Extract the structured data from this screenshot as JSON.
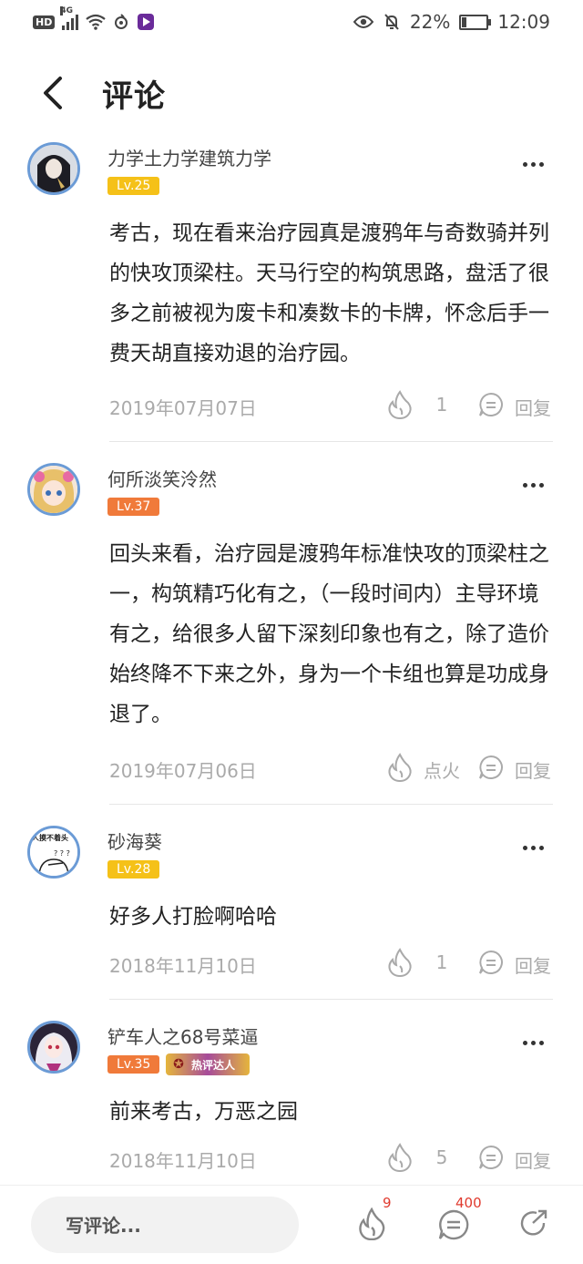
{
  "status_bar": {
    "hd": "HD",
    "network": "4G",
    "battery": "22%",
    "battery_level": 0.22,
    "time": "12:09"
  },
  "header": {
    "title": "评论"
  },
  "comments": [
    {
      "username": "力学土力学建筑力学",
      "level": "Lv.25",
      "level_color": "#f5c118",
      "content": "考古，现在看来治疗园真是渡鸦年与奇数骑并列的快攻顶梁柱。天马行空的构筑思路，盘活了很多之前被视为废卡和凑数卡的卡牌，怀念后手一费天胡直接劝退的治疗园。",
      "date": "2019年07月07日",
      "fire": "1",
      "reply": "回复"
    },
    {
      "username": "何所淡笑泠然",
      "level": "Lv.37",
      "level_color": "#f07a3a",
      "content": "回头来看，治疗园是渡鸦年标准快攻的顶梁柱之一，构筑精巧化有之，（一段时间内）主导环境有之，给很多人留下深刻印象也有之，除了造价始终降不下来之外，身为一个卡组也算是功成身退了。",
      "date": "2019年07月06日",
      "fire": "点火",
      "reply": "回复"
    },
    {
      "username": "砂海葵",
      "level": "Lv.28",
      "level_color": "#f5c118",
      "avatar_text": "人摸不着头",
      "content": "好多人打脸啊哈哈",
      "date": "2018年11月10日",
      "fire": "1",
      "reply": "回复"
    },
    {
      "username": "铲车人之68号菜逼",
      "level": "Lv.35",
      "level_color": "#f07a3a",
      "medal": "热评达人",
      "content": "前来考古，万恶之园",
      "date": "2018年11月10日",
      "fire": "5",
      "reply": "回复"
    }
  ],
  "bottom_bar": {
    "input_placeholder": "写评论...",
    "fire_count": "9",
    "comment_count": "400"
  },
  "colors": {
    "accent_red": "#e03a2e",
    "level_yellow": "#f5c118",
    "level_orange": "#f07a3a",
    "avatar_border": "#6b9bd6"
  }
}
